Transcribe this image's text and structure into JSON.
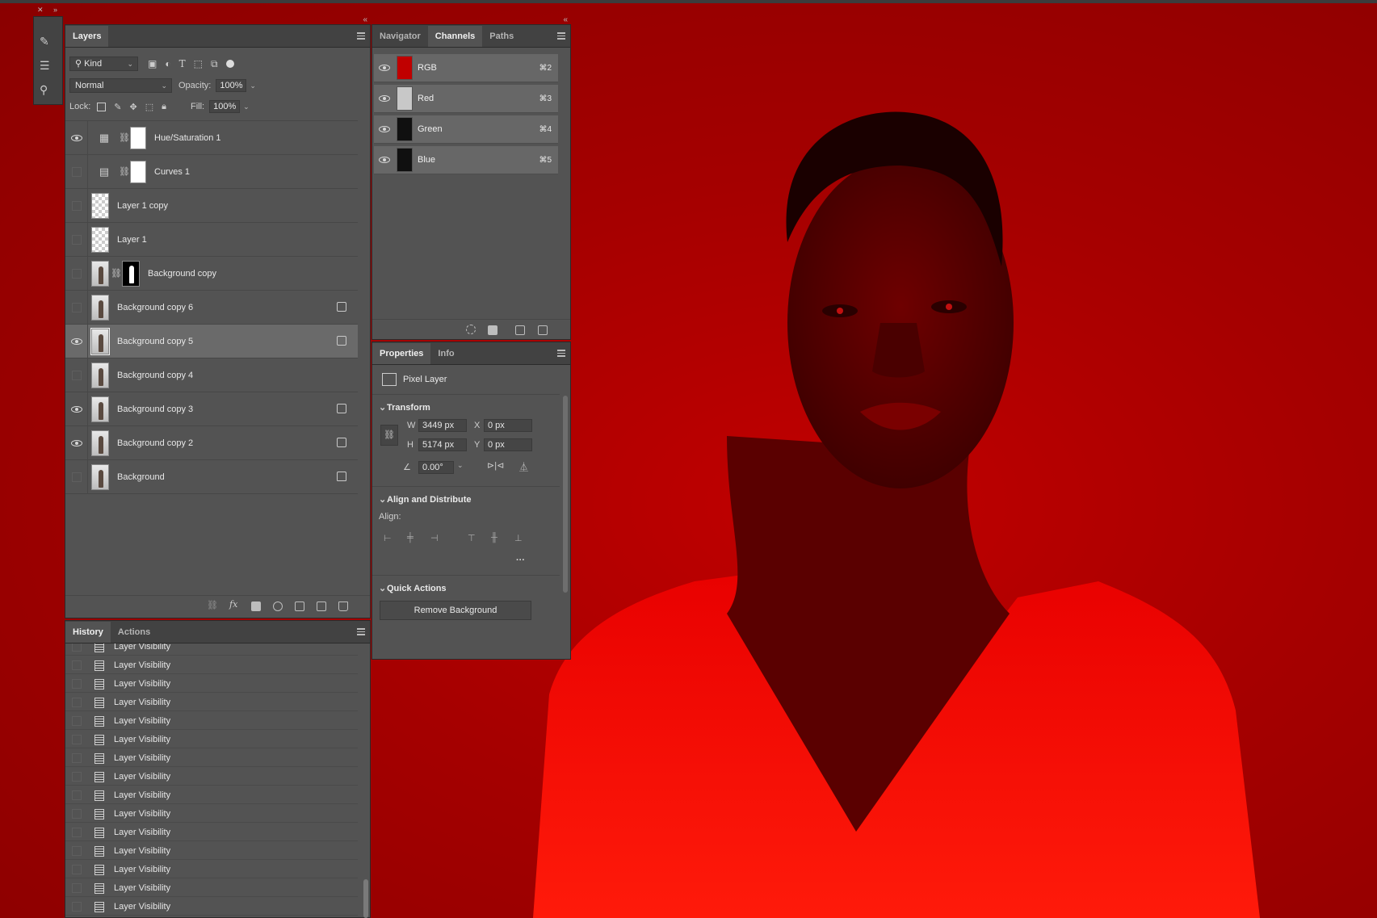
{
  "colors": {
    "canvas": "#a50000",
    "panel": "#535353",
    "panel_dark": "#424242",
    "selected_row": "#6a6a6a"
  },
  "layers_panel": {
    "tab": "Layers",
    "filter_kind": "Kind",
    "blend_mode": "Normal",
    "opacity_label": "Opacity:",
    "opacity_value": "100%",
    "lock_label": "Lock:",
    "fill_label": "Fill:",
    "fill_value": "100%",
    "layers": [
      {
        "name": "Hue/Saturation 1",
        "visible": true,
        "kind": "adjustment-hue",
        "selected": false
      },
      {
        "name": "Curves 1",
        "visible": false,
        "kind": "adjustment-curves",
        "selected": false
      },
      {
        "name": "Layer 1 copy",
        "visible": false,
        "kind": "transparent",
        "selected": false
      },
      {
        "name": "Layer 1",
        "visible": false,
        "kind": "transparent",
        "selected": false
      },
      {
        "name": "Background copy",
        "visible": false,
        "kind": "masked-photo",
        "selected": false
      },
      {
        "name": "Background copy 6",
        "visible": false,
        "kind": "photo-smart",
        "selected": false
      },
      {
        "name": "Background copy 5",
        "visible": true,
        "kind": "photo-smart",
        "selected": true
      },
      {
        "name": "Background copy 4",
        "visible": false,
        "kind": "photo",
        "selected": false
      },
      {
        "name": "Background copy 3",
        "visible": true,
        "kind": "photo-smart",
        "selected": false
      },
      {
        "name": "Background copy 2",
        "visible": true,
        "kind": "photo-smart",
        "selected": false
      },
      {
        "name": "Background",
        "visible": false,
        "kind": "photo-locked",
        "selected": false
      }
    ]
  },
  "history_panel": {
    "tabs": [
      "History",
      "Actions"
    ],
    "items": [
      "Layer Visibility",
      "Layer Visibility",
      "Layer Visibility",
      "Layer Visibility",
      "Layer Visibility",
      "Layer Visibility",
      "Layer Visibility",
      "Layer Visibility",
      "Layer Visibility",
      "Layer Visibility",
      "Layer Visibility",
      "Layer Visibility",
      "Layer Visibility",
      "Layer Visibility",
      "Layer Visibility"
    ]
  },
  "channels_panel": {
    "tabs": [
      "Navigator",
      "Channels",
      "Paths"
    ],
    "channels": [
      {
        "name": "RGB",
        "shortcut": "⌘2",
        "thumb": "#c00000"
      },
      {
        "name": "Red",
        "shortcut": "⌘3",
        "thumb": "#c8c8c8"
      },
      {
        "name": "Green",
        "shortcut": "⌘4",
        "thumb": "#101010"
      },
      {
        "name": "Blue",
        "shortcut": "⌘5",
        "thumb": "#101010"
      }
    ]
  },
  "properties_panel": {
    "tabs": [
      "Properties",
      "Info"
    ],
    "layer_type": "Pixel Layer",
    "transform_title": "Transform",
    "w_label": "W",
    "w_value": "3449 px",
    "h_label": "H",
    "h_value": "5174 px",
    "x_label": "X",
    "x_value": "0 px",
    "y_label": "Y",
    "y_value": "0 px",
    "angle_value": "0.00°",
    "align_title": "Align and Distribute",
    "align_label": "Align:",
    "more": "···",
    "quick_title": "Quick Actions",
    "remove_bg": "Remove Background"
  }
}
